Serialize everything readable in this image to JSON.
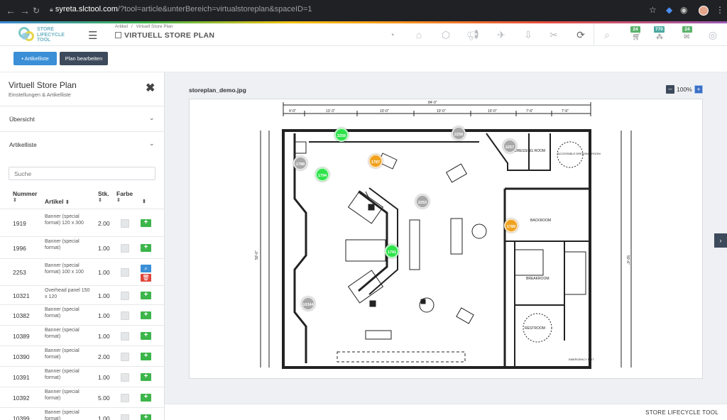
{
  "browser": {
    "url_host": "syreta.slctool.com",
    "url_path": "/?tool=article&unterBereich=virtualstoreplan&spaceID=1"
  },
  "header": {
    "logo_text": "STORE LIFECYCLE TOOL",
    "breadcrumb_parent": "Artikel",
    "breadcrumb_sep": "/",
    "breadcrumb_current": "Virtuell Store Plan",
    "title": "VIRTUELL STORE PLAN",
    "badges": {
      "cart": "24",
      "network": "770",
      "mail": "24"
    },
    "colors": {
      "badge_green": "#5bb26a",
      "badge_teal": "#4aa8a0"
    }
  },
  "toolbar": {
    "artikelliste_label": "Artikelliste",
    "plan_bearbeiten_label": "Plan bearbeiten"
  },
  "panel": {
    "title": "Virtuell Store Plan",
    "subtitle": "Einstellungen & Artikelliste",
    "accordion_overview": "Übersicht",
    "accordion_articles": "Artikelliste",
    "search_placeholder": "Suche",
    "columns": {
      "number": "Nummer",
      "article": "Artikel",
      "qty": "Stk.",
      "color": "Farbe"
    },
    "rows": [
      {
        "number": "1919",
        "article": "Banner (special format) 120 x 300",
        "qty": "2.00",
        "mode": "add"
      },
      {
        "number": "1996",
        "article": "Banner (special format)",
        "qty": "1.00",
        "mode": "add"
      },
      {
        "number": "2253",
        "article": "Banner (special format) 100 x 100",
        "qty": "1.00",
        "mode": "edit"
      },
      {
        "number": "10321",
        "article": "Overhead panel 150 x 120",
        "qty": "1.00",
        "mode": "add"
      },
      {
        "number": "10382",
        "article": "Banner (special format)",
        "qty": "1.00",
        "mode": "add"
      },
      {
        "number": "10389",
        "article": "Banner (special format)",
        "qty": "1.00",
        "mode": "add"
      },
      {
        "number": "10390",
        "article": "Banner (special format)",
        "qty": "2.00",
        "mode": "add"
      },
      {
        "number": "10391",
        "article": "Banner (special format)",
        "qty": "1.00",
        "mode": "add"
      },
      {
        "number": "10392",
        "article": "Banner (special format)",
        "qty": "5.00",
        "mode": "add"
      },
      {
        "number": "10399",
        "article": "Banner (special format)",
        "qty": "1.00",
        "mode": "add"
      }
    ]
  },
  "main": {
    "filename": "storeplan_demo.jpg",
    "zoom": "100%",
    "footer": "STORE LIFECYCLE TOOL",
    "markers": [
      {
        "label": "2259",
        "color": "green"
      },
      {
        "label": "1787",
        "color": "orange"
      },
      {
        "label": "2258",
        "color": "gray"
      },
      {
        "label": "2257",
        "color": "gray"
      },
      {
        "label": "1788",
        "color": "gray"
      },
      {
        "label": "1794",
        "color": "green"
      },
      {
        "label": "2253",
        "color": "gray"
      },
      {
        "label": "1789",
        "color": "orange"
      },
      {
        "label": "1791",
        "color": "green"
      },
      {
        "label": "10344",
        "color": "gray"
      }
    ],
    "plan_labels": {
      "dim_top": "84'-0\"",
      "dim_1": "4'-0\"",
      "dim_2": "13'-3\"",
      "dim_3": "10'-0\"",
      "dim_4": "10'-0\"",
      "dim_5": "10'-0\"",
      "dim_6": "8'-0\"",
      "dim_7": "7'-6\"",
      "dim_8": "7'-6\"",
      "dim_left": "50'-0\"",
      "dim_right": "50'-6\"",
      "dressing": "DRESSING ROOM",
      "accessible": "ACCESSIBLE DRESSING ROOM",
      "backroom": "BACKROOM",
      "breakroom": "BREAKROOM",
      "restroom": "RESTROOM",
      "emergency": "EMERGENCY EXIT"
    }
  }
}
